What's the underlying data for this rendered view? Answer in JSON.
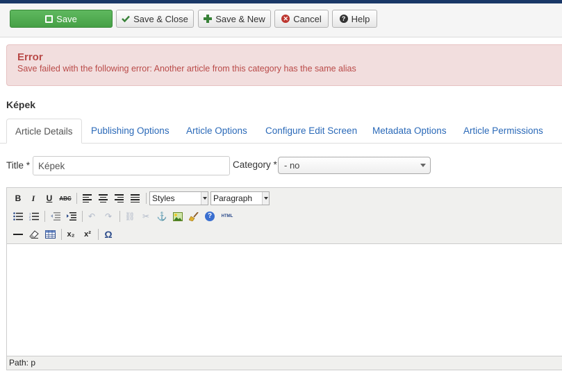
{
  "toolbar": {
    "save_label": "Save",
    "save_close_label": "Save & Close",
    "save_new_label": "Save & New",
    "cancel_label": "Cancel",
    "help_label": "Help"
  },
  "alert": {
    "title": "Error",
    "message": "Save failed with the following error: Another article from this category has the same alias"
  },
  "page_title": "Képek",
  "tabs": [
    {
      "label": "Article Details",
      "active": true
    },
    {
      "label": "Publishing Options"
    },
    {
      "label": "Article Options"
    },
    {
      "label": "Configure Edit Screen"
    },
    {
      "label": "Metadata Options"
    },
    {
      "label": "Article Permissions"
    }
  ],
  "form": {
    "title_label": "Title *",
    "title_value": "Képek",
    "category_label": "Category *",
    "category_value": "- no"
  },
  "editor": {
    "styles_value": "Styles",
    "format_value": "Paragraph",
    "buttons": {
      "bold": "B",
      "italic": "I",
      "underline": "U",
      "strike": "ABC",
      "subscript": "x₂",
      "superscript": "x²",
      "special_char": "Ω",
      "html": "HTML"
    },
    "path_label": "Path: p"
  },
  "colors": {
    "save_green": "#46a046",
    "alert_bg": "#f2dede",
    "alert_text": "#b94a48",
    "link_blue": "#2a69b8",
    "top_bar": "#1a3867"
  }
}
